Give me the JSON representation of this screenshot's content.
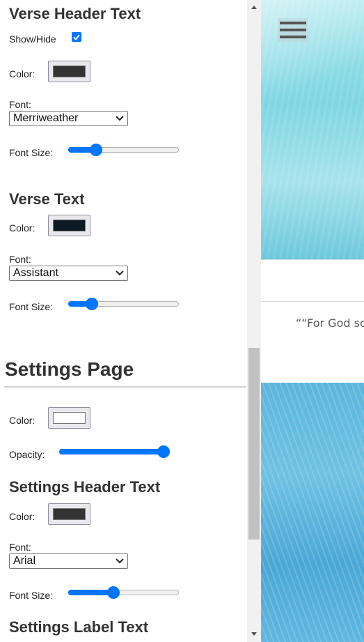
{
  "verse_header": {
    "title": "Verse Header Text",
    "show_hide_label": "Show/Hide",
    "show_checked": true,
    "color_label": "Color:",
    "color_value": "#333333",
    "font_label": "Font:",
    "font_value": "Merriweather",
    "font_size_label": "Font Size:",
    "font_size_fraction": 0.22
  },
  "verse_text": {
    "title": "Verse Text",
    "color_label": "Color:",
    "color_value": "#0b1a24",
    "font_label": "Font:",
    "font_value": "Assistant",
    "font_size_label": "Font Size:",
    "font_size_fraction": 0.18
  },
  "settings_page": {
    "title": "Settings Page",
    "color_label": "Color:",
    "color_value": "#ffffff",
    "opacity_label": "Opacity:",
    "opacity_fraction": 1.0
  },
  "settings_header": {
    "title": "Settings Header Text",
    "color_label": "Color:",
    "color_value": "#333333",
    "font_label": "Font:",
    "font_value": "Arial",
    "font_size_label": "Font Size:",
    "font_size_fraction": 0.4
  },
  "settings_label": {
    "title": "Settings Label Text"
  },
  "preview": {
    "verse_snippet": "““For God so"
  },
  "icons": {
    "menu": "hamburger-menu-icon",
    "scroll_up": "scroll-up-arrow-icon",
    "scroll_down": "scroll-down-arrow-icon",
    "dropdown": "chevron-down-icon",
    "check": "checkmark-icon"
  },
  "colors": {
    "accent": "#0075ff"
  }
}
